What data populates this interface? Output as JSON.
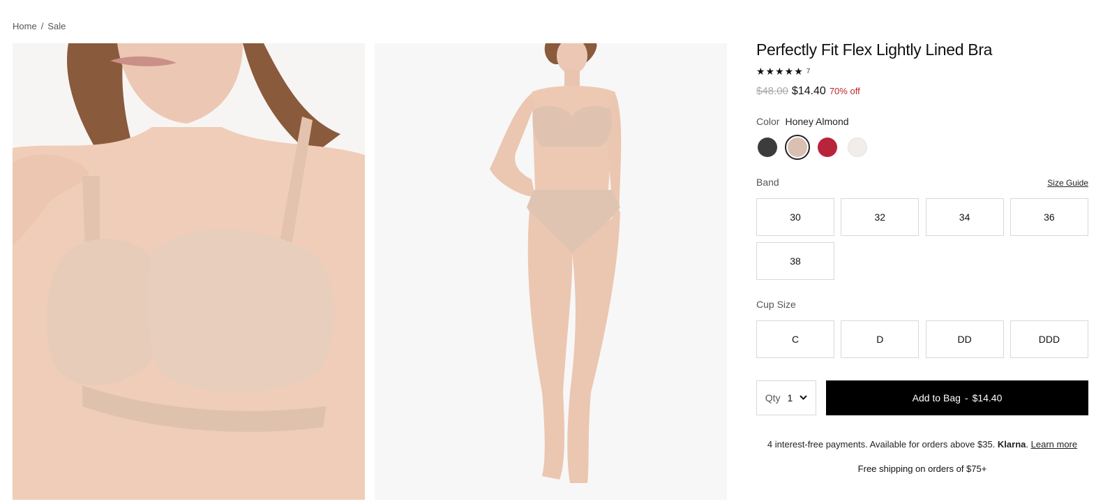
{
  "breadcrumb": {
    "home": "Home",
    "separator": "/",
    "current": "Sale"
  },
  "product": {
    "title": "Perfectly Fit Flex Lightly Lined Bra",
    "stars": "★★★★★",
    "rating_count": "7",
    "price_old": "$48.00",
    "price_new": "$14.40",
    "discount": "70% off"
  },
  "color": {
    "label": "Color",
    "selected_name": "Honey Almond",
    "swatches": [
      {
        "name": "black",
        "hex": "#3c3c3c"
      },
      {
        "name": "honey-almond",
        "hex": "#d9c0b2"
      },
      {
        "name": "red",
        "hex": "#b8243a"
      },
      {
        "name": "white",
        "hex": "#f3ede9"
      }
    ]
  },
  "band": {
    "label": "Band",
    "size_guide": "Size Guide",
    "sizes": [
      "30",
      "32",
      "34",
      "36",
      "38"
    ]
  },
  "cup": {
    "label": "Cup Size",
    "sizes": [
      "C",
      "D",
      "DD",
      "DDD"
    ]
  },
  "purchase": {
    "qty_label": "Qty",
    "qty_value": "1",
    "add_label": "Add to Bag",
    "add_sep": "-",
    "add_price": "$14.40"
  },
  "klarna": {
    "text": "4 interest-free payments. Available for orders above $35.",
    "brand": "Klarna",
    "period": ".",
    "link": "Learn more"
  },
  "shipping": "Free shipping on orders of $75+",
  "colors": {
    "accent_sale": "#c0272d",
    "button_bg": "#000000"
  }
}
